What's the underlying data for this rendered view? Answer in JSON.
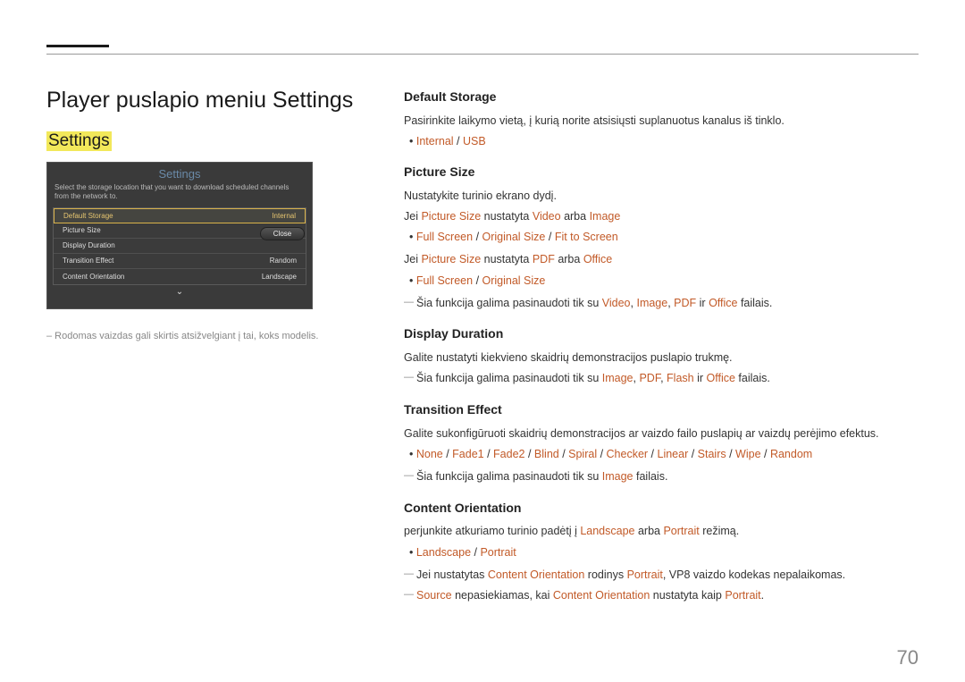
{
  "pageNumber": "70",
  "pageTitle": "Player puslapio meniu Settings",
  "sectionHighlight": "Settings",
  "figure": {
    "title": "Settings",
    "subtitle": "Select the storage location that you want to download scheduled channels from the network to.",
    "rows": [
      {
        "label": "Default Storage",
        "value": "Internal",
        "selected": true
      },
      {
        "label": "Picture Size",
        "value": ""
      },
      {
        "label": "Display Duration",
        "value": ""
      },
      {
        "label": "Transition Effect",
        "value": "Random"
      },
      {
        "label": "Content Orientation",
        "value": "Landscape"
      }
    ],
    "closeLabel": "Close"
  },
  "figureNote": "– Rodomas vaizdas gali skirtis atsižvelgiant į tai, koks modelis.",
  "right": {
    "defaultStorage": {
      "heading": "Default Storage",
      "desc": "Pasirinkite laikymo vietą, į kurią norite atsisiųsti suplanuotus kanalus iš tinklo.",
      "opt1": "Internal",
      "sep1": " / ",
      "opt2": "USB"
    },
    "pictureSize": {
      "heading": "Picture Size",
      "desc": "Nustatykite turinio ekrano dydį.",
      "line1a": "Jei ",
      "line1b": "Picture Size",
      "line1c": " nustatyta ",
      "line1d": "Video",
      "line1e": " arba ",
      "line1f": "Image",
      "o1": "Full Screen",
      "s": " / ",
      "o2": "Original Size",
      "o3": "Fit to Screen",
      "line2a": "Jei ",
      "line2b": "Picture Size",
      "line2c": " nustatyta ",
      "line2d": "PDF",
      "line2e": " arba ",
      "line2f": "Office",
      "note1a": "Šia funkcija galima pasinaudoti tik su ",
      "note1b": "Video",
      "note1c": ", ",
      "note1d": "Image",
      "note1e": ", ",
      "note1f": "PDF",
      "note1g": " ir ",
      "note1h": "Office",
      "note1i": " failais."
    },
    "displayDuration": {
      "heading": "Display Duration",
      "desc": "Galite nustatyti kiekvieno skaidrių demonstracijos puslapio trukmę.",
      "note1a": "Šia funkcija galima pasinaudoti tik su ",
      "n1": "Image",
      "c": ", ",
      "n2": "PDF",
      "n3": "Flash",
      "and": " ir ",
      "n4": "Office",
      "end": " failais."
    },
    "transitionEffect": {
      "heading": "Transition Effect",
      "desc": "Galite sukonfigūruoti skaidrių demonstracijos ar vaizdo failo puslapių ar vaizdų perėjimo efektus.",
      "o": [
        "None",
        "Fade1",
        "Fade2",
        "Blind",
        "Spiral",
        "Checker",
        "Linear",
        "Stairs",
        "Wipe",
        "Random"
      ],
      "s": " / ",
      "noteA": "Šia funkcija galima pasinaudoti tik su ",
      "noteB": "Image",
      "noteC": " failais."
    },
    "contentOrientation": {
      "heading": "Content Orientation",
      "descA": "perjunkite atkuriamo turinio padėtį į ",
      "descB": "Landscape",
      "descC": " arba ",
      "descD": "Portrait",
      "descE": " režimą.",
      "o1": "Landscape",
      "s": " / ",
      "o2": "Portrait",
      "n1a": "Jei nustatytas ",
      "n1b": "Content Orientation",
      "n1c": " rodinys ",
      "n1d": "Portrait",
      "n1e": ", VP8 vaizdo kodekas nepalaikomas.",
      "n2a": "Source",
      "n2b": " nepasiekiamas, kai ",
      "n2c": "Content Orientation",
      "n2d": " nustatyta kaip ",
      "n2e": "Portrait",
      "n2f": "."
    }
  }
}
